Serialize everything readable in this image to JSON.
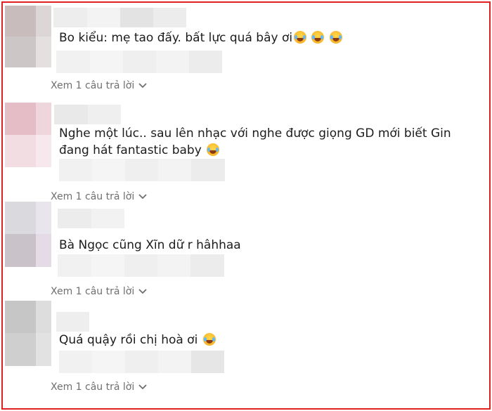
{
  "comments": [
    {
      "text": "Bo kiểu: mẹ tao đấy. bất lực quá bây ơi",
      "emoji_count": 3,
      "replies_label": "Xem 1 câu trả lời"
    },
    {
      "text_line1": "Nghe một lúc.. sau lên nhạc với nghe được giọng GD mới biết Gin",
      "text_line2": "đang hát fantastic baby",
      "emoji_count": 1,
      "replies_label": "Xem 1 câu trả lời"
    },
    {
      "text": "Bà Ngọc cũng Xĩn dữ r hâhhaa",
      "emoji_count": 0,
      "replies_label": "Xem 1 câu trả lời"
    },
    {
      "text": "Quá quậy rồi chị hoà ơi",
      "emoji_count": 1,
      "replies_label": "Xem 1 câu trả lời"
    }
  ],
  "icons": {
    "emoji": "laughing-tears-emoji-icon",
    "expand": "chevron-down-icon"
  },
  "colors": {
    "frame_border": "#e02020",
    "reply_text": "#6f6f6f",
    "comment_text": "#1c1c1c"
  }
}
